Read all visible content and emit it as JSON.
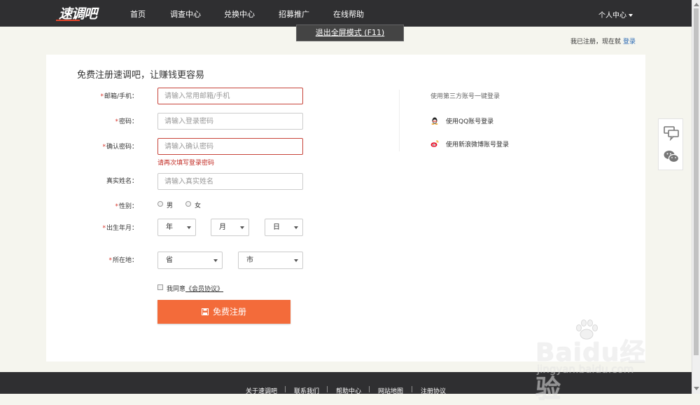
{
  "app": {
    "logo_text": "速调吧"
  },
  "nav": {
    "items": [
      "首页",
      "调查中心",
      "兑换中心",
      "招募推广",
      "在线帮助"
    ],
    "user_menu": "个人中心"
  },
  "fullscreen_bar": {
    "label": "退出全屏模式 (F11)"
  },
  "login_hint": {
    "text": "我已注册，现在就",
    "link": "登录"
  },
  "form": {
    "title": "免费注册速调吧，让赚钱更容易",
    "email": {
      "label": "邮箱/手机：",
      "placeholder": "请输入常用邮箱/手机",
      "value": ""
    },
    "password": {
      "label": "密码：",
      "placeholder": "请输入登录密码",
      "value": ""
    },
    "confirm": {
      "label": "确认密码：",
      "placeholder": "请输入确认密码",
      "value": "",
      "error": "请再次填写登录密码"
    },
    "realname": {
      "label": "真实姓名：",
      "placeholder": "请输入真实姓名",
      "value": ""
    },
    "gender": {
      "label": "性别：",
      "options": [
        "男",
        "女"
      ]
    },
    "birth": {
      "label": "出生年月：",
      "year": "年",
      "month": "月",
      "day": "日"
    },
    "location": {
      "label": "所在地：",
      "province": "省",
      "city": "市"
    },
    "agree": {
      "text": "我同意",
      "link": "《会员协议》"
    },
    "submit_label": "免费注册"
  },
  "third_party": {
    "title": "使用第三方账号一键登录",
    "qq": "使用QQ账号登录",
    "weibo": "使用新浪微博账号登录"
  },
  "side_tools": {
    "icons": [
      "feedback-icon",
      "wechat-icon"
    ]
  },
  "footer": {
    "links": [
      "关于速调吧",
      "联系我们",
      "帮助中心",
      "网站地图",
      "注册协议"
    ],
    "separator": "|"
  },
  "watermark": {
    "text": "Baidu经验",
    "sub": "jingyan.baidu.com"
  },
  "colors": {
    "accent": "#f36b3a",
    "nav_bg": "#2f2f31",
    "error": "#c22a22",
    "link": "#2d6bb4"
  }
}
